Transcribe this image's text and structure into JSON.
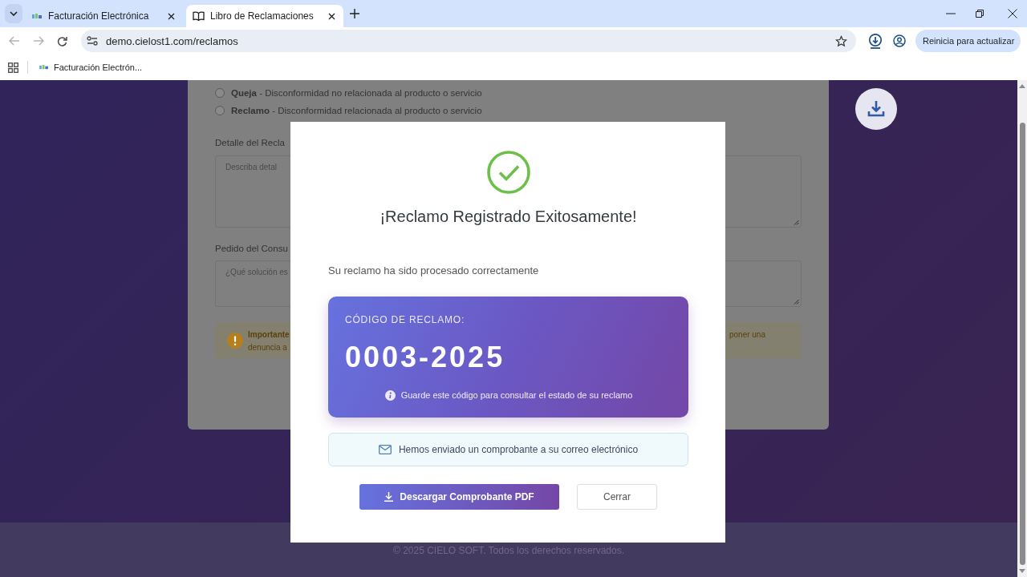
{
  "browser": {
    "tabs": [
      {
        "title": "Facturación Electrónica",
        "selected": false
      },
      {
        "title": "Libro de Reclamaciones",
        "selected": true
      }
    ],
    "address": "demo.cielost1.com/reclamos",
    "update_button": "Reinicia para actualizar",
    "bookmarks": [
      "Facturación Electrón..."
    ]
  },
  "form": {
    "radios": [
      {
        "text": "**Queja** - Disconformidad no relacionada al producto o servicio",
        "selected": false
      },
      {
        "text": "**Reclamo** - Disconformidad relacionada al producto o servicio",
        "selected": false
      }
    ],
    "fields": [
      {
        "label": "Detalle del Recla",
        "placeholder": "Describa detal"
      },
      {
        "label": "Pedido del Consu",
        "placeholder": "¿Qué solución es"
      }
    ],
    "notice": {
      "title": "Importante",
      "lines": [
        "denuncia a"
      ],
      "right_fragment": "poner una"
    }
  },
  "footer": "© 2025 CIELO SOFT. Todos los derechos reservados.",
  "modal": {
    "title": "¡Reclamo Registrado Exitosamente!",
    "message": "Su reclamo ha sido procesado correctamente",
    "code_label": "CÓDIGO DE RECLAMO:",
    "code": "0003-2025",
    "code_hint": "Guarde este código para consultar el estado de su reclamo",
    "email_notice": "Hemos enviado un comprobante a su correo electrónico",
    "buttons": [
      {
        "label": "Descargar Comprobante PDF",
        "kind": "primary"
      },
      {
        "label": "Cerrar",
        "kind": "secondary"
      }
    ]
  }
}
